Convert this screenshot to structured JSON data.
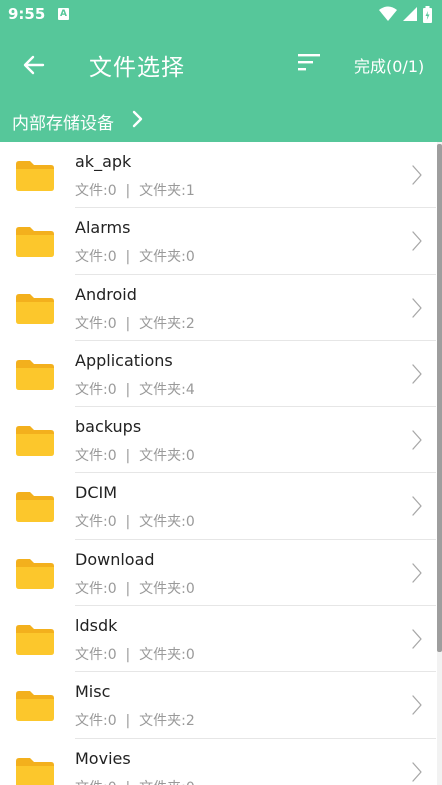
{
  "status": {
    "time": "9:55",
    "app_icon_letter": "A",
    "icons": [
      "wifi-icon",
      "signal-icon",
      "battery-icon"
    ]
  },
  "app_bar": {
    "title": "文件选择",
    "done_label": "完成(0/1)",
    "icons": [
      "back-arrow-icon",
      "sort-icon"
    ]
  },
  "breadcrumb": {
    "root": "内部存储设备"
  },
  "files": [
    {
      "name": "ak_apk",
      "meta": "文件:0  |  文件夹:1"
    },
    {
      "name": "Alarms",
      "meta": "文件:0  |  文件夹:0"
    },
    {
      "name": "Android",
      "meta": "文件:0  |  文件夹:2"
    },
    {
      "name": "Applications",
      "meta": "文件:0  |  文件夹:4"
    },
    {
      "name": "backups",
      "meta": "文件:0  |  文件夹:0"
    },
    {
      "name": "DCIM",
      "meta": "文件:0  |  文件夹:0"
    },
    {
      "name": "Download",
      "meta": "文件:0  |  文件夹:0"
    },
    {
      "name": "ldsdk",
      "meta": "文件:0  |  文件夹:0"
    },
    {
      "name": "Misc",
      "meta": "文件:0  |  文件夹:2"
    },
    {
      "name": "Movies",
      "meta": "文件:0  |  文件夹:0"
    }
  ],
  "colors": {
    "primary": "#56c79a",
    "folder": "#fcc72c",
    "folder_tab": "#f3b01d",
    "meta_text": "#9a9a9a"
  }
}
